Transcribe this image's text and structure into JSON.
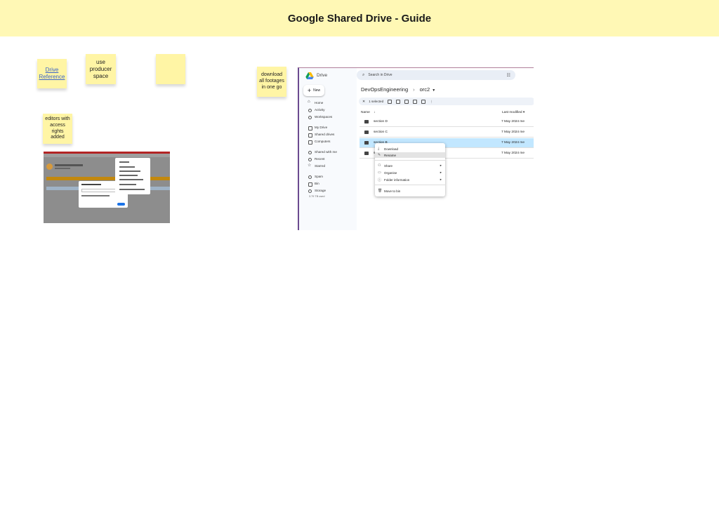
{
  "banner": {
    "title": "Google Shared Drive - Guide",
    "color": "#fff8b5"
  },
  "stickies": [
    {
      "text": "Drive Reference",
      "link": true
    },
    {
      "text": "use producer space"
    },
    {
      "text": ""
    },
    {
      "text": "download all footages in one go"
    },
    {
      "text": "editors with access rights added"
    }
  ],
  "drive": {
    "app_name": "Drive",
    "new_label": "New",
    "search_placeholder": "Search in Drive",
    "nav": [
      {
        "label": "Home",
        "icon": "home-icon"
      },
      {
        "label": "Activity",
        "icon": "activity-icon"
      },
      {
        "label": "Workspaces",
        "icon": "workspaces-icon"
      },
      {
        "label": "My Drive",
        "icon": "my-drive-icon"
      },
      {
        "label": "Shared drives",
        "icon": "shared-drives-icon"
      },
      {
        "label": "Computers",
        "icon": "computers-icon"
      },
      {
        "label": "Shared with me",
        "icon": "shared-with-me-icon"
      },
      {
        "label": "Recent",
        "icon": "recent-icon"
      },
      {
        "label": "Starred",
        "icon": "star-icon"
      },
      {
        "label": "Spam",
        "icon": "spam-icon"
      },
      {
        "label": "Bin",
        "icon": "bin-icon"
      },
      {
        "label": "Storage",
        "icon": "cloud-icon"
      }
    ],
    "storage_text": "3.79 TB used",
    "breadcrumb": [
      "DevOpsEngineering",
      "orc2"
    ],
    "selection_text": "1 selected",
    "columns": {
      "name": "Name",
      "last_modified": "Last modified"
    },
    "files": [
      {
        "name": "section D",
        "modified": "7 May 2024 me",
        "selected": false
      },
      {
        "name": "section C",
        "modified": "7 May 2024 me",
        "selected": false
      },
      {
        "name": "section B",
        "modified": "7 May 2024 me",
        "selected": true
      },
      {
        "name": "section A",
        "modified": "7 May 2024 me",
        "selected": false
      }
    ],
    "context_menu": [
      {
        "label": "Download",
        "icon": "download-icon"
      },
      {
        "label": "Rename",
        "icon": "rename-icon",
        "highlighted": true
      },
      {
        "label": "Share",
        "icon": "share-icon",
        "submenu": true
      },
      {
        "label": "Organise",
        "icon": "organise-icon",
        "submenu": true
      },
      {
        "label": "Folder information",
        "icon": "info-icon",
        "submenu": true
      },
      {
        "label": "Move to bin",
        "icon": "bin-icon"
      }
    ]
  },
  "small_screenshot": {
    "header": "DevOpsEngineering",
    "dialog_title": "Manage members"
  }
}
